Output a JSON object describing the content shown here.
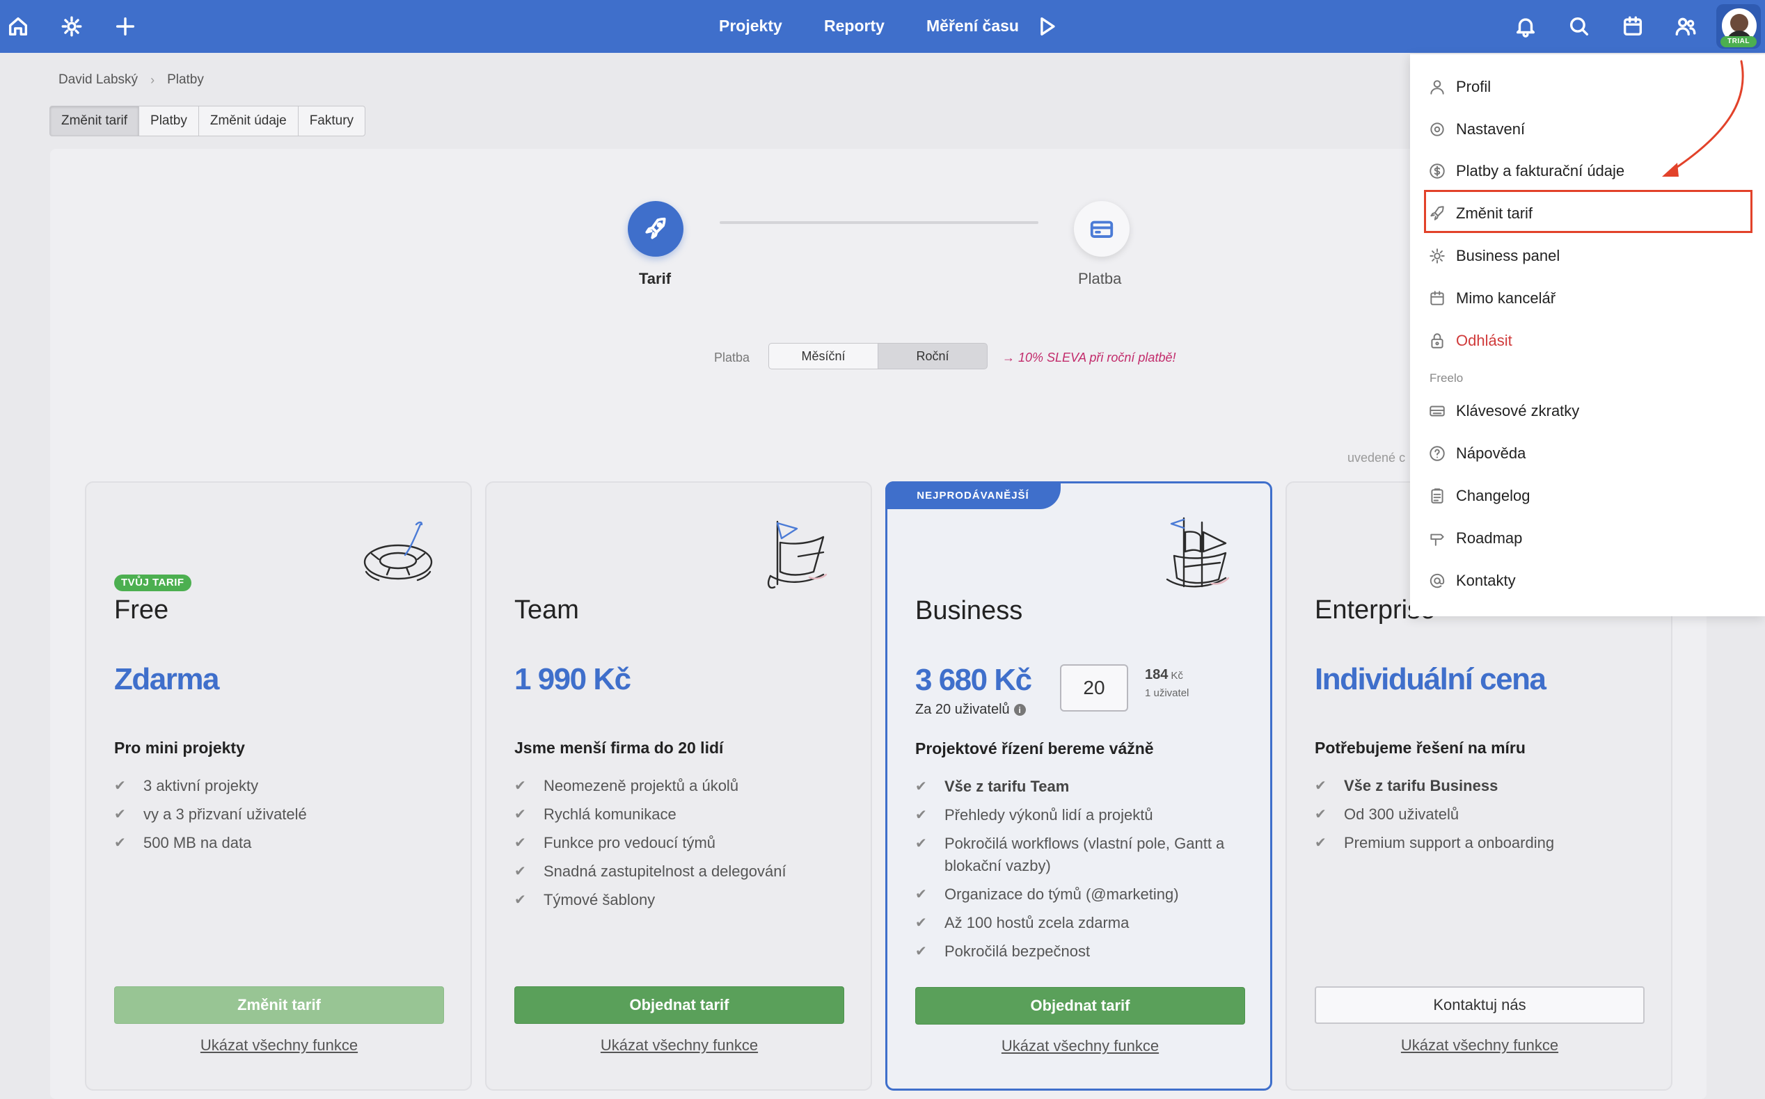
{
  "topbar": {
    "nav": [
      "Projekty",
      "Reporty",
      "Měření času"
    ],
    "icons_left": [
      "home-icon",
      "gear-icon",
      "plus-icon"
    ],
    "icons_right": [
      "bell-icon",
      "search-icon",
      "calendar-icon",
      "users-icon"
    ],
    "trial_badge": "TRIAL"
  },
  "breadcrumb": {
    "user": "David Labský",
    "page": "Platby"
  },
  "tabs": [
    "Změnit tarif",
    "Platby",
    "Změnit údaje",
    "Faktury"
  ],
  "steps": {
    "step1": "Tarif",
    "step2": "Platba"
  },
  "billing": {
    "label": "Platba",
    "monthly": "Měsíční",
    "yearly": "Roční",
    "discount": "→ 10% SLEVA při roční platbě!",
    "note": "uvedené c"
  },
  "cards": [
    {
      "badge": "TVŮJ TARIF",
      "name": "Free",
      "price": "Zdarma",
      "tagline": "Pro mini projekty",
      "features": [
        "3 aktivní projekty",
        "vy a 3 přizvaní uživatelé",
        "500 MB na data"
      ],
      "button": "Změnit tarif",
      "link": "Ukázat všechny funkce"
    },
    {
      "name": "Team",
      "price": "1 990 Kč",
      "tagline": "Jsme menší firma do 20 lidí",
      "features": [
        "Neomezeně projektů a úkolů",
        "Rychlá komunikace",
        "Funkce pro vedoucí týmů",
        "Snadná zastupitelnost a delegování",
        "Týmové šablony"
      ],
      "button": "Objednat tarif",
      "link": "Ukázat všechny funkce"
    },
    {
      "ribbon": "NEJPRODÁVANĚJŠÍ",
      "name": "Business",
      "price": "3 680 Kč",
      "price_sub": "Za 20 uživatelů",
      "users": "20",
      "per_user_value": "184",
      "per_user_unit": "Kč",
      "per_user_label": "1 uživatel",
      "tagline": "Projektové řízení bereme vážně",
      "feature_first": "Vše z tarifu Team",
      "features": [
        "Přehledy výkonů lidí a projektů",
        "Pokročilá workflows (vlastní pole, Gantt a blokační vazby)",
        "Organizace do týmů (@marketing)",
        "Až 100 hostů zcela zdarma",
        "Pokročilá bezpečnost"
      ],
      "button": "Objednat tarif",
      "link": "Ukázat všechny funkce"
    },
    {
      "name": "Enterprise",
      "price": "Individuální cena",
      "tagline": "Potřebujeme řešení na míru",
      "feature_first": "Vše z tarifu Business",
      "features": [
        "Od 300 uživatelů",
        "Premium support a onboarding"
      ],
      "button": "Kontaktuj nás",
      "link": "Ukázat všechny funkce"
    }
  ],
  "menu": {
    "items": [
      "Profil",
      "Nastavení",
      "Platby a fakturační údaje",
      "Změnit tarif",
      "Business panel",
      "Mimo kancelář",
      "Odhlásit"
    ],
    "section": "Freelo",
    "section_items": [
      "Klávesové zkratky",
      "Nápověda",
      "Changelog",
      "Roadmap",
      "Kontakty"
    ]
  },
  "colors": {
    "brand": "#3f6fcb",
    "success": "#5aa05a",
    "danger": "#d03a3a",
    "annotation": "#e2422a",
    "discount": "#c22b6b"
  }
}
